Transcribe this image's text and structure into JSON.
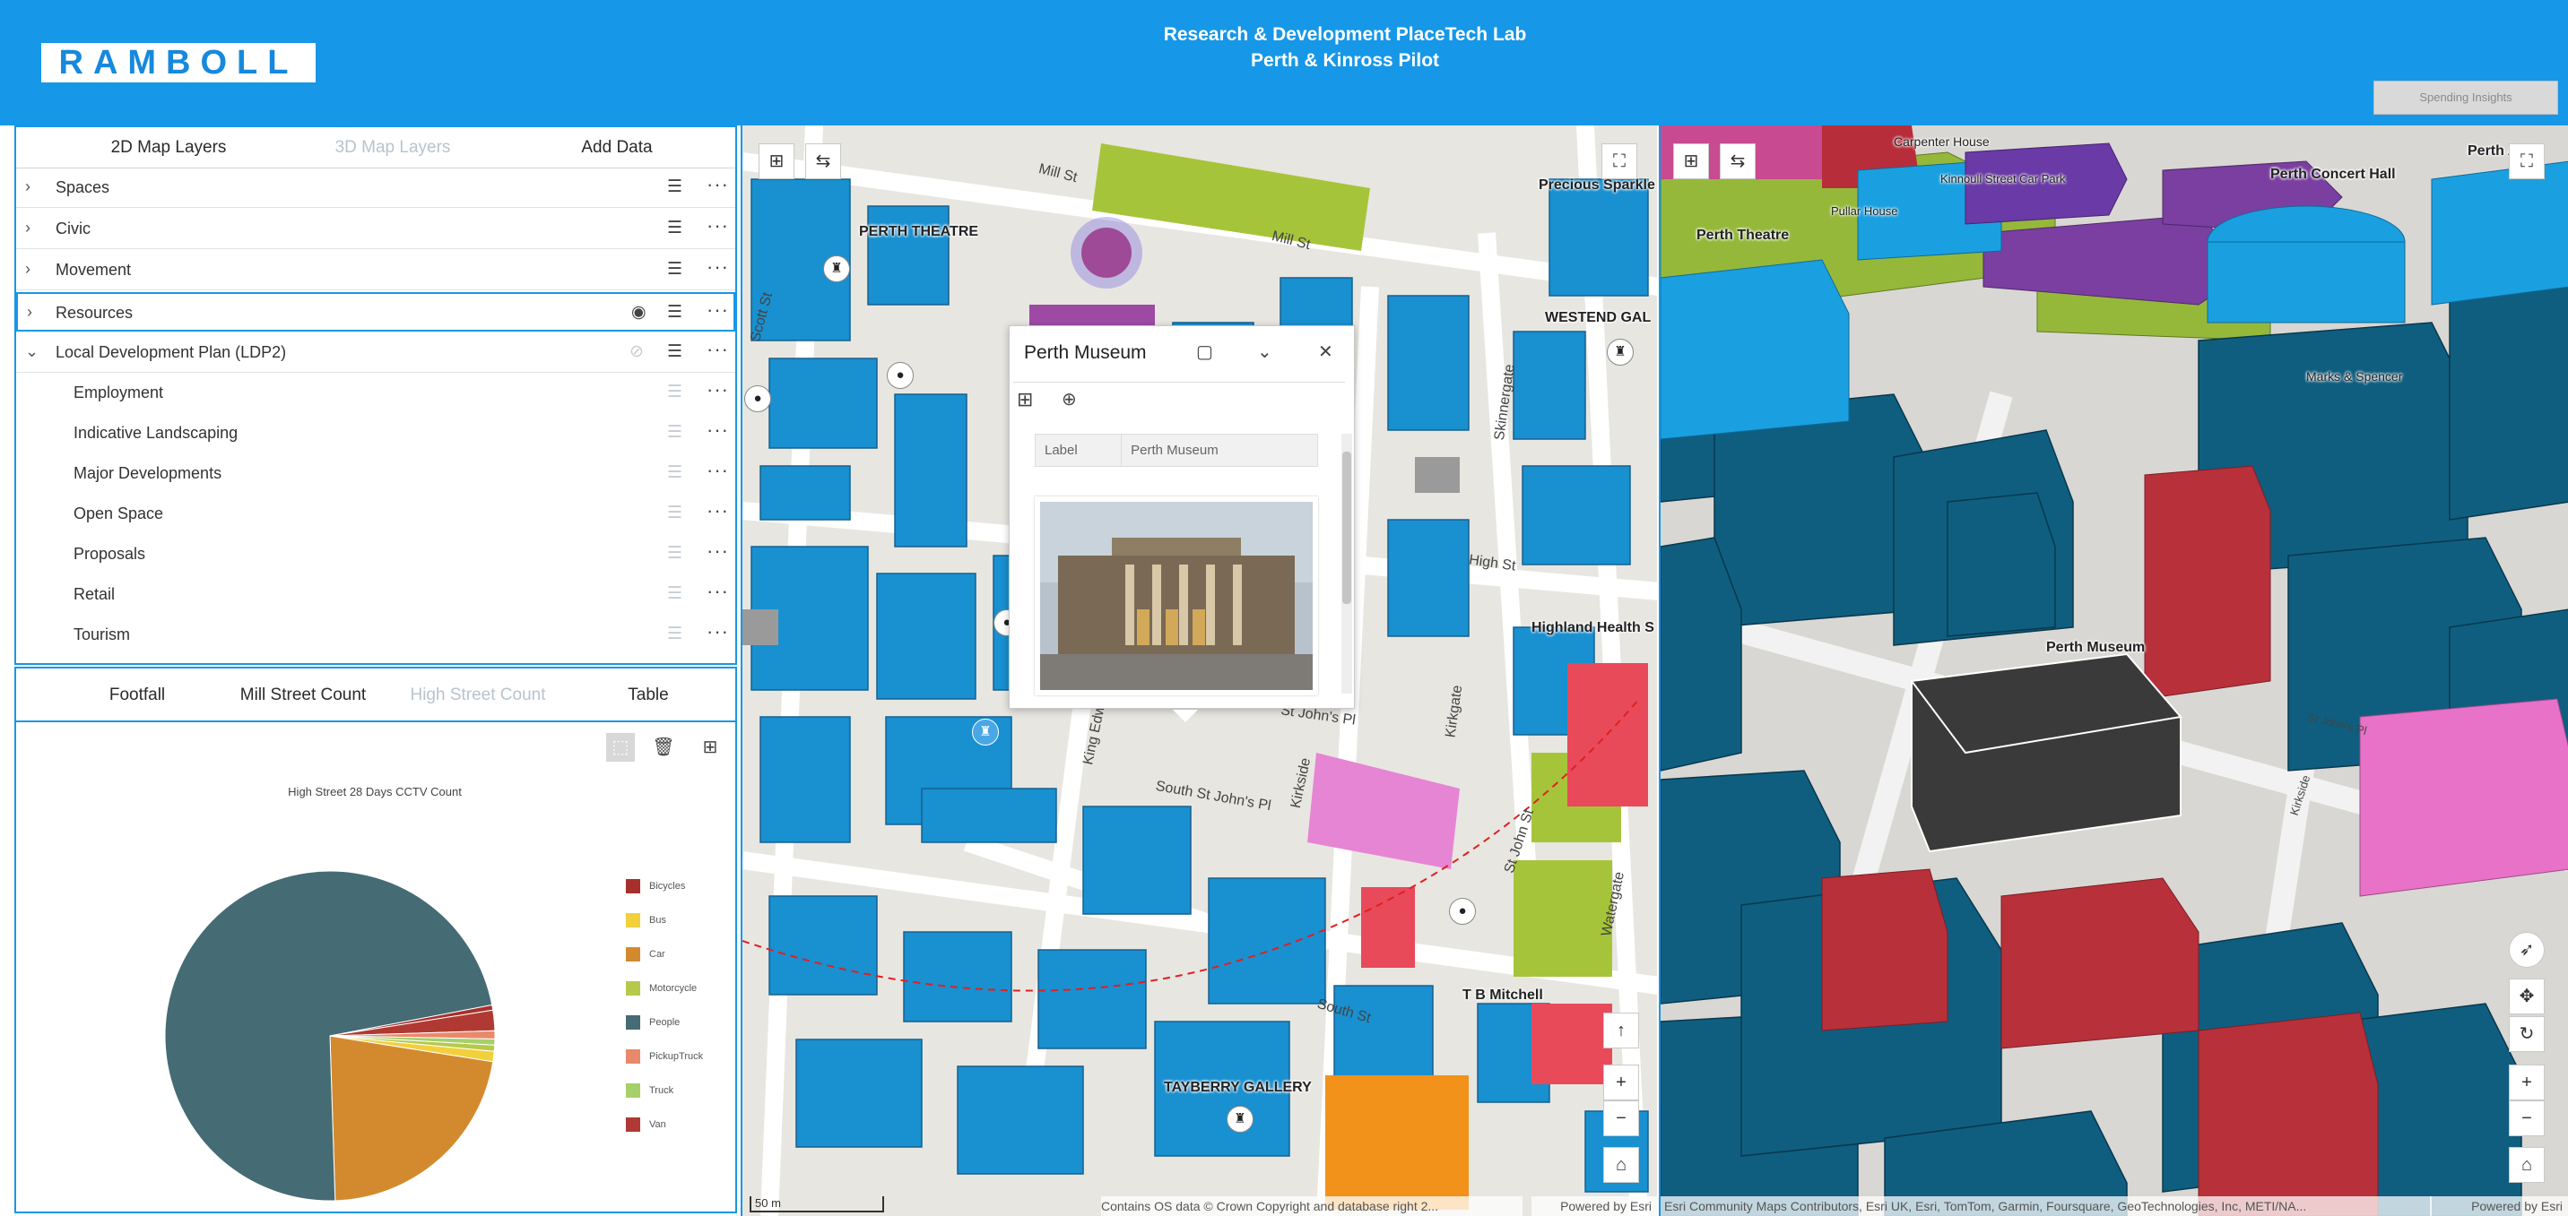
{
  "header": {
    "logo": "RAMBOLL",
    "title_line1": "Research & Development PlaceTech Lab",
    "title_line2": "Perth & Kinross Pilot",
    "insights_button": "Spending Insights",
    "background": "#1697e8"
  },
  "layer_panel": {
    "tabs": [
      "2D Map Layers",
      "3D Map Layers",
      "Add Data"
    ],
    "groups": [
      {
        "label": "Spaces"
      },
      {
        "label": "Civic"
      },
      {
        "label": "Movement"
      },
      {
        "label": "Resources"
      },
      {
        "label": "Local Development Plan (LDP2)"
      }
    ],
    "sublayers": [
      "Employment",
      "Indicative Landscaping",
      "Major Developments",
      "Open Space",
      "Proposals",
      "Retail",
      "Tourism"
    ],
    "icons": {
      "expand": "chevron-right-icon",
      "collapse": "chevron-down-icon",
      "legend": "legend-list-icon",
      "visible": "eye-icon",
      "hidden": "eye-off-icon",
      "more": "more-dots-icon"
    }
  },
  "chart_panel": {
    "tabs": [
      "Footfall",
      "Mill Street Count",
      "High Street Count",
      "Table"
    ],
    "tools": [
      "selection-icon",
      "clear-selection-icon",
      "grid-icon"
    ]
  },
  "chart_data": {
    "type": "pie",
    "title": "High Street 28 Days CCTV Count",
    "categories": [
      "Bicycles",
      "Bus",
      "Car",
      "Motorcycle",
      "People",
      "PickupTruck",
      "Truck",
      "Van"
    ],
    "values": [
      0.5,
      1.0,
      22.0,
      0.6,
      72.5,
      0.8,
      0.6,
      2.0
    ],
    "colors": [
      "#a8302b",
      "#f2d03c",
      "#d38a2f",
      "#b7c94a",
      "#456b74",
      "#e8896b",
      "#a5d06a",
      "#b03a33"
    ],
    "legend_position": "right"
  },
  "map2d": {
    "labels": [
      "PERTH THEATRE",
      "Precious Sparkle",
      "WESTEND GAL",
      "Highland Health S",
      "T B Mitchell",
      "TAYBERRY GALLERY"
    ],
    "streets": [
      "Mill St",
      "Mill St",
      "Scott St",
      "High St",
      "Skinnergate",
      "King Edward",
      "St John's Pl",
      "South St John's Pl",
      "Kirkside",
      "Kirkgate",
      "St John St",
      "South St",
      "Watergate"
    ],
    "scale": "50 m",
    "attribution": "Contains OS data © Crown Copyright and database right 2...",
    "powered_by": "Powered by Esri"
  },
  "popup": {
    "title": "Perth Museum",
    "field_label": "Label",
    "field_value": "Perth Museum",
    "buttons": [
      "dock-icon",
      "collapse-icon",
      "close-icon"
    ],
    "tools": [
      "grid-icon",
      "zoom-to-icon"
    ]
  },
  "map3d": {
    "labels": [
      "Carpenter House",
      "Kinnoull Street Car Park",
      "Pullar House",
      "Perth Concert Hall",
      "Perth Theatre",
      "Perth Museum",
      "Marks & Spencer",
      "St John's Pl",
      "Kirkside",
      "Perth Art G"
    ],
    "attribution": "Esri Community Maps Contributors, Esri UK, Esri, TomTom, Garmin, Foursquare, GeoTechnologies, Inc, METI/NA...",
    "powered_by": "Powered by Esri"
  }
}
